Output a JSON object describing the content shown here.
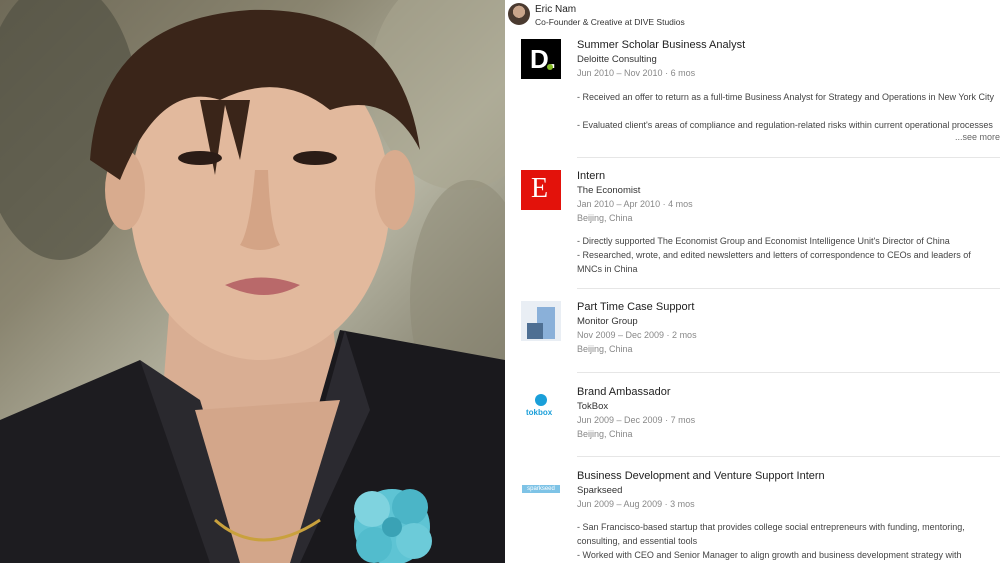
{
  "profile": {
    "name": "Eric Nam",
    "headline": "Co-Founder & Creative at DIVE Studios"
  },
  "entries": [
    {
      "title": "Summer Scholar Business Analyst",
      "company": "Deloitte Consulting",
      "dates": "Jun 2010 – Nov 2010 · 6 mos",
      "desc": [
        "- Received an offer to return as a full-time Business Analyst for Strategy and Operations in New York City",
        "- Evaluated client's areas of compliance and regulation-related risks within current operational processes"
      ],
      "see_more": "...see more",
      "logo": "deloitte-logo",
      "logo_text": "D."
    },
    {
      "title": "Intern",
      "company": "The Economist",
      "dates": "Jan 2010 – Apr 2010 · 4 mos",
      "location": "Beijing, China",
      "desc": [
        "- Directly supported The Economist Group and Economist Intelligence Unit's Director of China",
        "- Researched, wrote, and edited newsletters and letters of correspondence to CEOs and leaders of MNCs in China"
      ],
      "logo": "economist-logo",
      "logo_text": "E"
    },
    {
      "title": "Part Time Case Support",
      "company": "Monitor Group",
      "dates": "Nov 2009 – Dec 2009 · 2 mos",
      "location": "Beijing, China",
      "logo": "monitor-group-logo"
    },
    {
      "title": "Brand Ambassador",
      "company": "TokBox",
      "dates": "Jun 2009 – Dec 2009 · 7 mos",
      "location": "Beijing, China",
      "logo": "tokbox-logo",
      "logo_text": "tokbox"
    },
    {
      "title": "Business Development and Venture Support Intern",
      "company": "Sparkseed",
      "dates": "Jun 2009 – Aug 2009 · 3 mos",
      "desc": [
        "- San Francisco-based startup that provides college social entrepreneurs with funding, mentoring, consulting, and essential tools",
        "- Worked with CEO and Senior Manager to align growth and business development strategy with"
      ],
      "logo": "sparkseed-logo",
      "logo_text": "sparkseed"
    }
  ],
  "colors": {
    "deloitte_bg": "#000000",
    "deloitte_dot": "#86bc25",
    "economist_red": "#e3120b",
    "tokbox_blue": "#1a9fd9",
    "divider": "#e6e6e6"
  }
}
